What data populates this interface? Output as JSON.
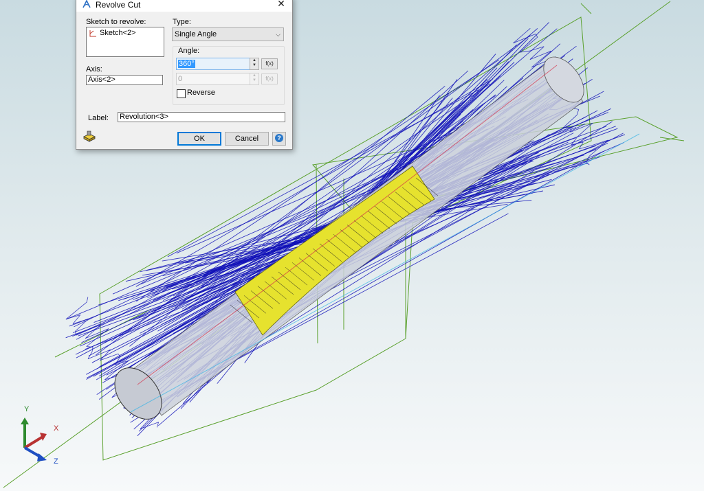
{
  "dialog": {
    "title": "Revolve Cut",
    "sketch_label": "Sketch to revolve:",
    "sketch_item": "Sketch<2>",
    "axis_label": "Axis:",
    "axis_value": "Axis<2>",
    "type_label": "Type:",
    "type_value": "Single Angle",
    "angle_label": "Angle:",
    "angle_value": "360°",
    "angle2_value": "0",
    "fx_label": "f(x)",
    "reverse_label": "Reverse",
    "label_label": "Label:",
    "label_value": "Revolution<3>",
    "ok_label": "OK",
    "cancel_label": "Cancel",
    "help_label": "?",
    "close_label": "✕"
  },
  "triad": {
    "x": "X",
    "y": "Y",
    "z": "Z"
  },
  "colors": {
    "wire": "#1010b8",
    "plane": "#5aa02c",
    "waist": "#e6e22e",
    "accent": "#0078d7"
  }
}
